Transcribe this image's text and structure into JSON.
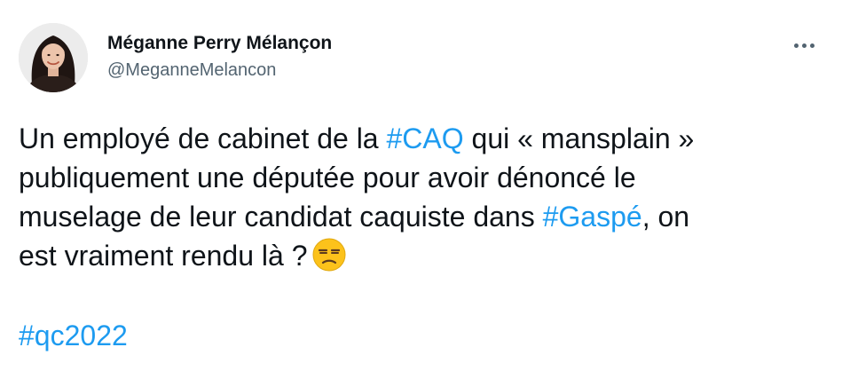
{
  "author": {
    "display_name": "Méganne Perry Mélançon",
    "handle": "@MeganneMelancon",
    "avatar_icon": "profile-photo"
  },
  "menu": {
    "icon": "more-options-icon"
  },
  "tweet": {
    "line1": {
      "before": "Un employé de cabinet de la ",
      "hashtag": "#CAQ",
      "after": " qui « mansplain »"
    },
    "line2": "publiquement une députée pour avoir dénoncé le",
    "line3": {
      "before": "muselage de leur candidat caquiste dans ",
      "hashtag": "#Gaspé",
      "after": ", on"
    },
    "line4": "est vraiment rendu là ?",
    "emoji": "unamused-face-emoji",
    "tags": "#qc2022"
  },
  "colors": {
    "link": "#1d9bf0",
    "text": "#0f1419",
    "secondary": "#536471"
  }
}
